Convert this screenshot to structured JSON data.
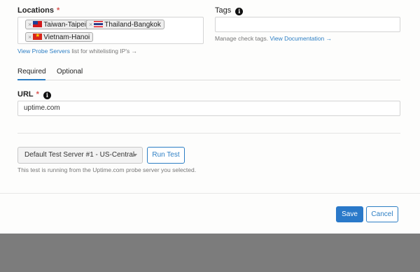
{
  "locations": {
    "label": "Locations",
    "required_mark": "*",
    "chips": [
      {
        "remove": "×",
        "label": "Taiwan-Taipei",
        "flag": "taiwan-flag"
      },
      {
        "remove": "×",
        "label": "Thailand-Bangkok",
        "flag": "thailand-flag"
      },
      {
        "remove": "×",
        "label": "Vietnam-Hanoi",
        "flag": "vietnam-flag"
      }
    ],
    "helper_link": "View Probe Servers",
    "helper_text": " list for whitelisting IP's →"
  },
  "tags": {
    "label": "Tags",
    "info_icon": "i",
    "value": "",
    "helper_text": "Manage check tags. ",
    "helper_link": "View Documentation →"
  },
  "tabs": [
    {
      "label": "Required",
      "active": true
    },
    {
      "label": "Optional",
      "active": false
    }
  ],
  "url": {
    "label": "URL",
    "required_mark": "*",
    "info_icon": "i",
    "value": "uptime.com"
  },
  "test": {
    "server_select": "Default Test Server #1 - US-Central",
    "run_button": "Run Test",
    "note": "This test is running from the Uptime.com probe server you selected."
  },
  "footer": {
    "save_label": "Save",
    "cancel_label": "Cancel"
  },
  "colors": {
    "accent": "#2c7ec4",
    "required": "#d9534f",
    "overlay": "#7c7c7c"
  }
}
